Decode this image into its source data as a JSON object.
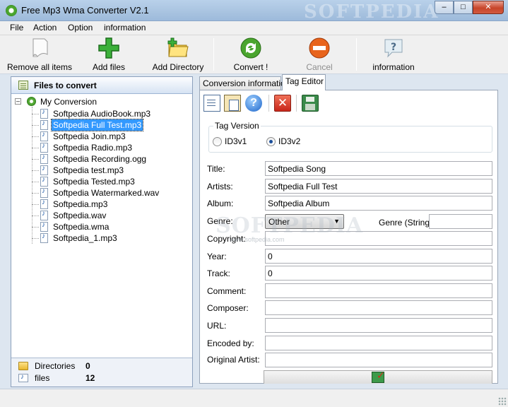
{
  "window": {
    "title": "Free Mp3 Wma Converter V2.1",
    "watermark": "SOFTPEDIA",
    "minimize": "–",
    "maximize": "□",
    "close": "✕"
  },
  "menu": [
    "File",
    "Action",
    "Option",
    "information"
  ],
  "toolbar": {
    "remove_all": "Remove all items",
    "add_files": "Add files",
    "add_directory": "Add Directory",
    "convert": "Convert !",
    "cancel": "Cancel",
    "information": "information"
  },
  "left_panel": {
    "header": "Files to convert",
    "root": "My Conversion",
    "files": [
      "Softpedia AudioBook.mp3",
      "Softpedia Full Test.mp3",
      "Softpedia Join.mp3",
      "Softpedia Radio.mp3",
      "Softpedia Recording.ogg",
      "Softpedia test.mp3",
      "Softpedia Tested.mp3",
      "Softpedia Watermarked.wav",
      "Softpedia.mp3",
      "Softpedia.wav",
      "Softpedia.wma",
      "Softpedia_1.mp3"
    ],
    "selected_index": 1,
    "stats": {
      "directories_label": "Directories",
      "directories_value": "0",
      "files_label": "files",
      "files_value": "12"
    }
  },
  "tabs": [
    "Conversion information",
    "Tag Editor"
  ],
  "active_tab": "Tag Editor",
  "tag_editor": {
    "icons": [
      "copy-tag-icon",
      "paste-tag-icon",
      "help-icon",
      "delete-tag-icon",
      "save-tag-icon"
    ],
    "help_glyph": "?",
    "delete_glyph": "✕",
    "tag_version_label": "Tag Version",
    "id3v1": "ID3v1",
    "id3v2": "ID3v2",
    "selected_version": "ID3v2",
    "labels": {
      "title": "Title:",
      "artists": "Artists:",
      "album": "Album:",
      "genre": "Genre:",
      "genre_string": "Genre (String):",
      "copyright": "Copyright:",
      "year": "Year:",
      "track": "Track:",
      "comment": "Comment:",
      "composer": "Composer:",
      "url": "URL:",
      "encoded_by": "Encoded by:",
      "original_artist": "Original Artist:"
    },
    "values": {
      "title": "Softpedia Song",
      "artists": "Softpedia Full Test",
      "album": "Softpedia Album",
      "genre": "Other",
      "genre_string": "",
      "copyright": "",
      "year": "0",
      "track": "0",
      "comment": "",
      "composer": "",
      "url": "",
      "encoded_by": "",
      "original_artist": ""
    },
    "watermark": "SOFTPEDIA",
    "watermark_url": "www.softpedia.com"
  },
  "colors": {
    "selection": "#3399ff",
    "convert_green": "#4aa52e",
    "cancel_orange": "#e8641c",
    "add_green": "#2fa82a"
  }
}
